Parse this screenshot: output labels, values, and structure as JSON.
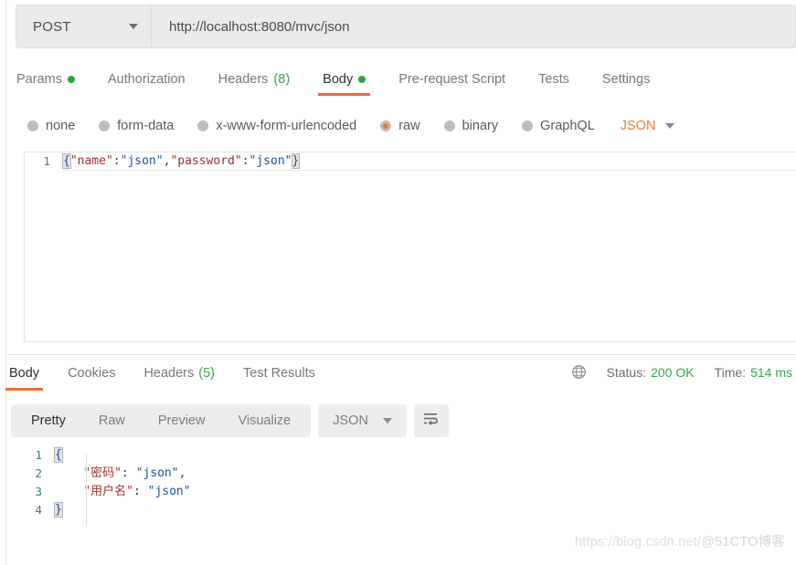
{
  "request": {
    "method": "POST",
    "url": "http://localhost:8080/mvc/json",
    "tabs": [
      {
        "label": "Params",
        "marker": "dot"
      },
      {
        "label": "Authorization",
        "marker": "none"
      },
      {
        "label": "Headers",
        "count": "(8)"
      },
      {
        "label": "Body",
        "marker": "dot"
      },
      {
        "label": "Pre-request Script",
        "marker": "none"
      },
      {
        "label": "Tests",
        "marker": "none"
      },
      {
        "label": "Settings",
        "marker": "none"
      }
    ],
    "body_types": [
      {
        "label": "none",
        "selected": false
      },
      {
        "label": "form-data",
        "selected": false
      },
      {
        "label": "x-www-form-urlencoded",
        "selected": false
      },
      {
        "label": "raw",
        "selected": true
      },
      {
        "label": "binary",
        "selected": false
      },
      {
        "label": "GraphQL",
        "selected": false
      }
    ],
    "raw_language": "JSON",
    "body_code": {
      "line_number": "1",
      "open_brace": "{",
      "key_name": "\"name\"",
      "colon1": ":",
      "val_name": "\"json\"",
      "comma": ",",
      "key_password": "\"password\"",
      "colon2": ":",
      "val_password": "\"json\"",
      "close_brace": "}"
    }
  },
  "response": {
    "tabs": [
      {
        "label": "Body",
        "count": ""
      },
      {
        "label": "Cookies",
        "count": ""
      },
      {
        "label": "Headers",
        "count": "(5)"
      },
      {
        "label": "Test Results",
        "count": ""
      }
    ],
    "status_label": "Status:",
    "status_value": "200 OK",
    "time_label": "Time:",
    "time_value": "514 ms",
    "view_modes": [
      "Pretty",
      "Raw",
      "Preview",
      "Visualize"
    ],
    "active_view": "Pretty",
    "format": "JSON",
    "code_lines": [
      {
        "n": "1",
        "indent": "",
        "key": "",
        "sep": "",
        "value": "",
        "trail": "",
        "brace": "{"
      },
      {
        "n": "2",
        "indent": "    ",
        "key": "\"密码\"",
        "sep": ": ",
        "value": "\"json\"",
        "trail": ",",
        "brace": ""
      },
      {
        "n": "3",
        "indent": "    ",
        "key": "\"用户名\"",
        "sep": ": ",
        "value": "\"json\"",
        "trail": "",
        "brace": ""
      },
      {
        "n": "4",
        "indent": "",
        "key": "",
        "sep": "",
        "value": "",
        "trail": "",
        "brace": "}"
      }
    ]
  },
  "watermark": {
    "url": "https://blog.csdn.net/",
    "tag": "@51CTO博客"
  },
  "colors": {
    "accent_orange": "#ef6c33",
    "raw_orange": "#f4772f",
    "status_green": "#2da84f",
    "count_green": "#3fa34a",
    "json_key": "#9c2f2f",
    "json_string": "#1a4f9c",
    "line_number": "#4e7a9e"
  }
}
